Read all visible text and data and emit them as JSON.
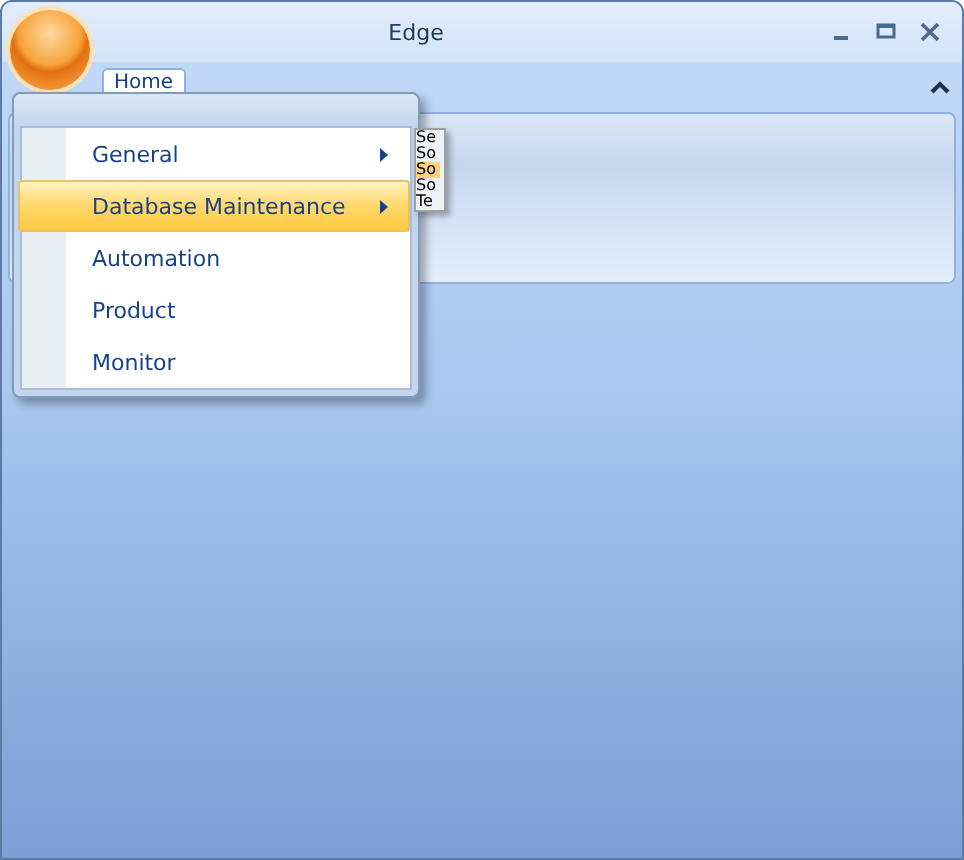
{
  "window": {
    "title": "Edge"
  },
  "ribbon": {
    "tabs": [
      {
        "label": "Home",
        "selected": true
      }
    ]
  },
  "app_menu": {
    "items": [
      {
        "label": "General",
        "has_submenu": true,
        "selected": false
      },
      {
        "label": "Database Maintenance",
        "has_submenu": true,
        "selected": true
      },
      {
        "label": "Automation",
        "has_submenu": false,
        "selected": false
      },
      {
        "label": "Product",
        "has_submenu": false,
        "selected": false
      },
      {
        "label": "Monitor",
        "has_submenu": false,
        "selected": false
      }
    ]
  },
  "submenu": {
    "items": [
      {
        "label": "Se",
        "selected": false
      },
      {
        "label": "So",
        "selected": false
      },
      {
        "label": "So",
        "selected": true
      },
      {
        "label": "So",
        "selected": false
      },
      {
        "label": "Te",
        "selected": false
      }
    ]
  }
}
